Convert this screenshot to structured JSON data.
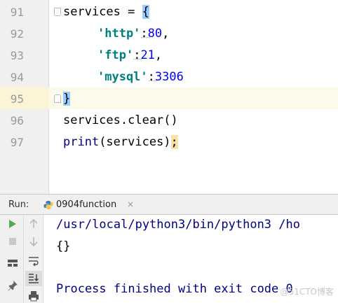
{
  "editor": {
    "line_numbers": [
      "91",
      "92",
      "93",
      "94",
      "95",
      "96",
      "97"
    ],
    "current_line": "95",
    "lines": {
      "l91": {
        "name": "services",
        "op": " = ",
        "brace": "{"
      },
      "l92": {
        "key": "'http'",
        "colon": ":",
        "value": "80",
        "comma": ","
      },
      "l93": {
        "key": "'ftp'",
        "colon": ":",
        "value": "21",
        "comma": ","
      },
      "l94": {
        "key": "'mysql'",
        "colon": ":",
        "value": "3306"
      },
      "l95": {
        "brace": "}"
      },
      "l96": {
        "text": "services.clear()"
      },
      "l97": {
        "func": "print",
        "args": "(services)",
        "semi": ";"
      }
    }
  },
  "run_panel": {
    "label": "Run:",
    "tab": {
      "title": "0904function",
      "close": "×"
    },
    "toolbar_left": [
      "run-icon",
      "stop-icon",
      "layout-icon",
      "pin-icon"
    ],
    "toolbar_right": [
      "up-arrow-icon",
      "down-arrow-icon",
      "soft-wrap-icon",
      "scroll-to-end-icon",
      "print-icon"
    ]
  },
  "console": {
    "command": "/usr/local/python3/bin/python3 /ho",
    "output": "{}",
    "exit": "Process finished with exit code 0",
    "watermark": "@51CTO博客"
  },
  "colors": {
    "string": "#008080",
    "number": "#0000ff",
    "builtin": "#000080",
    "brace_highlight": "#99ccff",
    "current_line": "#fcfae9",
    "run_green": "#4caf50"
  }
}
